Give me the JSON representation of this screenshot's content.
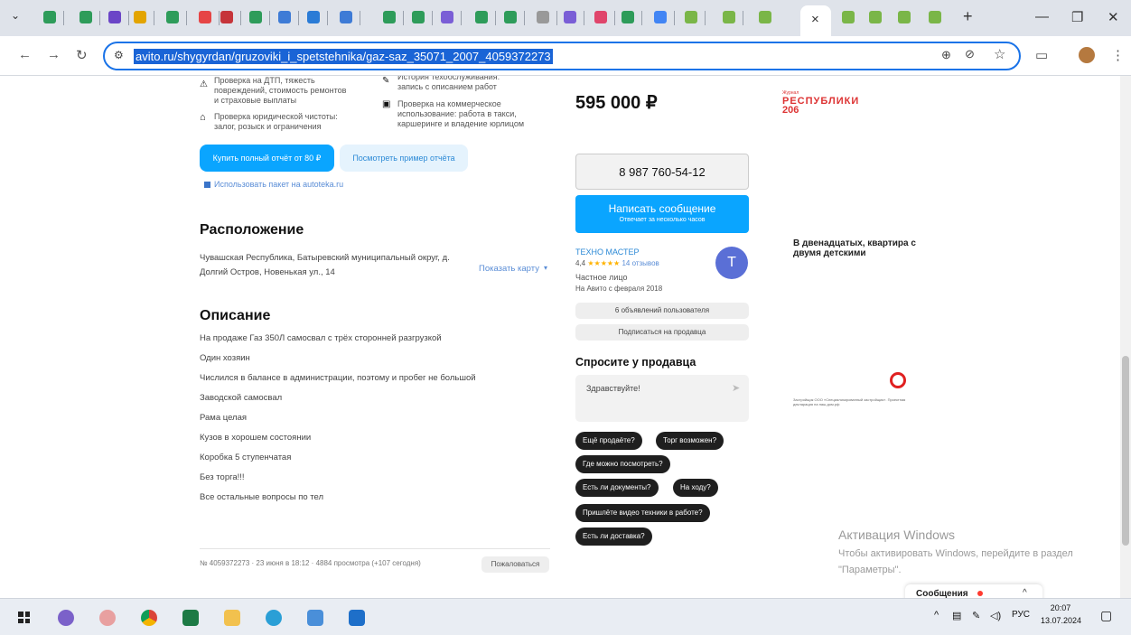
{
  "browser": {
    "tab_glyphs": {
      "close": "×",
      "new_tab": "+"
    },
    "url": "avito.ru/shygyrdan/gruzoviki_i_spetstehnika/gaz-saz_35071_2007_4059372273",
    "window_controls": {
      "minimize": "—",
      "restore": "❐",
      "close": "✕"
    }
  },
  "report_section": {
    "items": [
      "Проверка на ДТП, тяжесть повреждений, стоимость ремонтов и страховые выплаты",
      "История техобслуживания: запись с описанием работ",
      "Проверка юридической чистоты: залог, розыск и ограничения",
      "Проверка на коммерческое использование: работа в такси, каршеринге и владение юрлицом"
    ],
    "buy_button": "Купить полный отчёт от 80 ₽",
    "example_button": "Посмотреть пример отчёта",
    "package_link": "Использовать пакет на autoteka.ru"
  },
  "location": {
    "heading": "Расположение",
    "address": "Чувашская Республика, Батыревский муниципальный округ, д. Долгий Остров, Новенькая ул., 14",
    "map_link": "Показать карту"
  },
  "description": {
    "heading": "Описание",
    "lines": [
      "На продаже Газ 350Л самосвал с трёх сторонней разгрузкой",
      "Один хозяин",
      "Числился в балансе в администрации, поэтому и пробег не большой",
      "Заводской самосвал",
      "Рама целая",
      "Кузов в хорошем состоянии",
      "Коробка 5 ступенчатая",
      "Без торга!!!",
      "Все остальные вопросы по тел"
    ]
  },
  "footer": {
    "meta": "№ 4059372273 · 23 июня в 18:12 · 4884 просмотра (+107 сегодня)",
    "report_button": "Пожаловаться"
  },
  "seller": {
    "price": "595 000 ₽",
    "phone": "8 987 760-54-12",
    "message_button": "Написать сообщение",
    "message_sub": "Отвечает за несколько часов",
    "name": "ТЕХНО МАСТЕР",
    "rating": "4,4",
    "stars": "★★★★★",
    "reviews": "14 отзывов",
    "type": "Частное лицо",
    "since": "На Авито с февраля 2018",
    "avatar_letter": "T",
    "ads_button": "6 объявлений пользователя",
    "subscribe_button": "Подписаться на продавца"
  },
  "ask": {
    "heading": "Спросите у продавца",
    "input_value": "Здравствуйте!",
    "send_glyph": "➤",
    "chips": [
      "Ещё продаёте?",
      "Торг возможен?",
      "Где можно посмотреть?",
      "Есть ли документы?",
      "На ходу?",
      "Пришлёте видео техники в работе?",
      "Есть ли доставка?"
    ]
  },
  "ads": {
    "ad1_small": "Журнал",
    "ad1_title": "РЕСПУБЛИКИ",
    "ad1_num": "206",
    "ad2_text": "В двенадцатых, квартира с двумя детскими",
    "ad3_small": "Застройщик ООО «Специализированный застройщик». Проектная декларация на наш.дом.рф"
  },
  "activation": {
    "title": "Активация Windows",
    "text": "Чтобы активировать Windows, перейдите в раздел \"Параметры\"."
  },
  "messages_bar": {
    "label": "Сообщения",
    "chevron": "^"
  },
  "taskbar": {
    "language": "РУС",
    "time": "20:07",
    "date": "13.07.2024"
  },
  "colors": {
    "accent": "#0aa5ff",
    "link": "#5a8dd6",
    "chrome": "#dfe3ea"
  }
}
